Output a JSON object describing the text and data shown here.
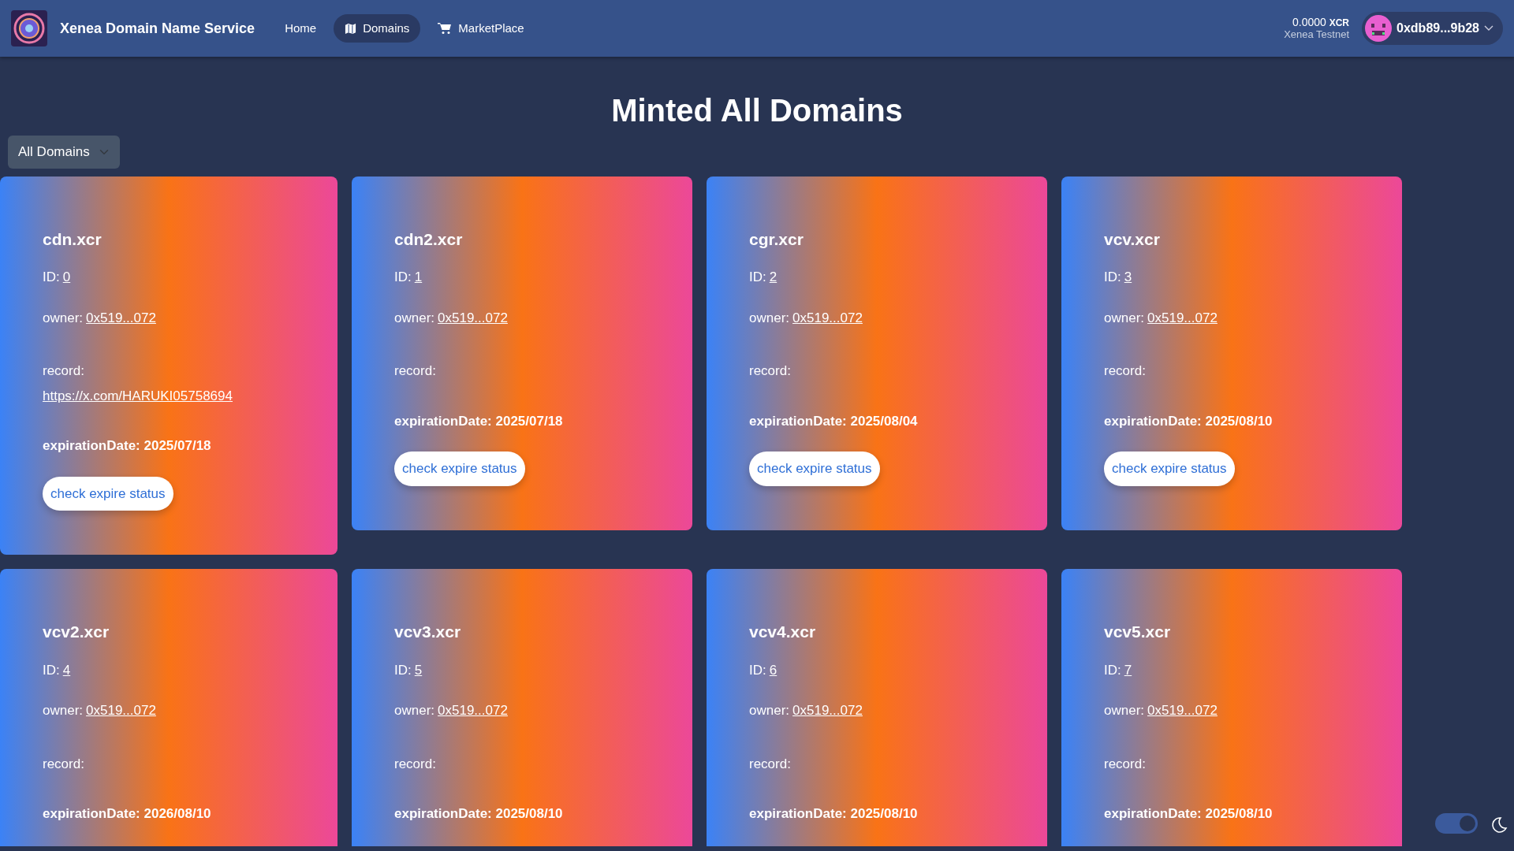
{
  "navbar": {
    "brand": "Xenea Domain Name Service",
    "links": [
      {
        "label": "Home",
        "selected": false
      },
      {
        "label": "Domains",
        "selected": true
      },
      {
        "label": "MarketPlace",
        "selected": false
      }
    ],
    "balance": "0.0000",
    "currency": "XCR",
    "network": "Xenea Testnet",
    "account": "0xdb89...9b28"
  },
  "heading": "Minted All Domains",
  "filter": {
    "value": "All Domains"
  },
  "domains": [
    {
      "name": "cdn.xcr",
      "id_label": "ID:",
      "id": "0",
      "owner_label": "owner:",
      "owner": "0x519...072",
      "record_label": "record:",
      "record": "https://x.com/HARUKI05758694",
      "expiration": "expirationDate: 2025/07/18",
      "button": "check expire status"
    },
    {
      "name": "cdn2.xcr",
      "id_label": "ID:",
      "id": "1",
      "owner_label": "owner:",
      "owner": "0x519...072",
      "record_label": "record:",
      "expiration": "expirationDate: 2025/07/18",
      "button": "check expire status"
    },
    {
      "name": "cgr.xcr",
      "id_label": "ID:",
      "id": "2",
      "owner_label": "owner:",
      "owner": "0x519...072",
      "record_label": "record:",
      "expiration": "expirationDate: 2025/08/04",
      "button": "check expire status"
    },
    {
      "name": "vcv.xcr",
      "id_label": "ID:",
      "id": "3",
      "owner_label": "owner:",
      "owner": "0x519...072",
      "record_label": "record:",
      "expiration": "expirationDate: 2025/08/10",
      "button": "check expire status"
    },
    {
      "name": "vcv2.xcr",
      "id_label": "ID:",
      "id": "4",
      "owner_label": "owner:",
      "owner": "0x519...072",
      "record_label": "record:",
      "expiration": "expirationDate: 2026/08/10"
    },
    {
      "name": "vcv3.xcr",
      "id_label": "ID:",
      "id": "5",
      "owner_label": "owner:",
      "owner": "0x519...072",
      "record_label": "record:",
      "expiration": "expirationDate: 2025/08/10"
    },
    {
      "name": "vcv4.xcr",
      "id_label": "ID:",
      "id": "6",
      "owner_label": "owner:",
      "owner": "0x519...072",
      "record_label": "record:",
      "expiration": "expirationDate: 2025/08/10"
    },
    {
      "name": "vcv5.xcr",
      "id_label": "ID:",
      "id": "7",
      "owner_label": "owner:",
      "owner": "0x519...072",
      "record_label": "record:",
      "expiration": "expirationDate: 2025/08/10"
    }
  ],
  "theme_toggle": {
    "on": true
  }
}
